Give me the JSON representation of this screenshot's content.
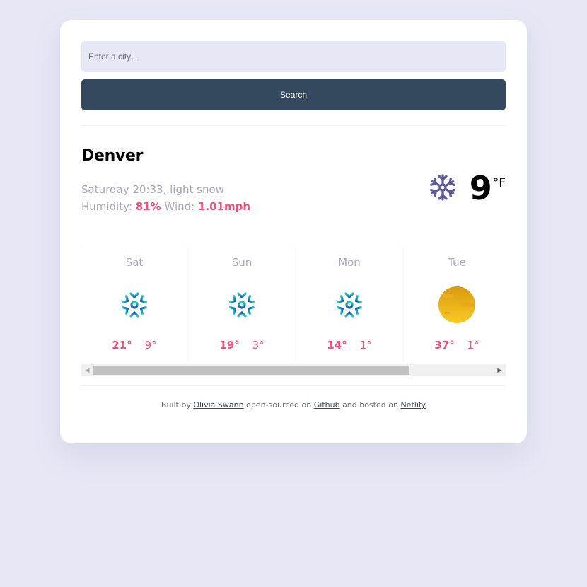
{
  "search": {
    "placeholder": "Enter a city...",
    "value": "",
    "button_label": "Search"
  },
  "current": {
    "city": "Denver",
    "day_time": "Saturday 20:33",
    "condition": "light snow",
    "humidity_label": "Humidity:",
    "humidity_value": "81%",
    "wind_label": "Wind:",
    "wind_value": "1.01mph",
    "icon": "snowflake-icon",
    "temperature": "9",
    "unit": "°F"
  },
  "forecast": [
    {
      "day": "Sat",
      "icon": "snowflake-icon",
      "high": "21°",
      "low": "9°"
    },
    {
      "day": "Sun",
      "icon": "snowflake-icon",
      "high": "19°",
      "low": "3°"
    },
    {
      "day": "Mon",
      "icon": "snowflake-icon",
      "high": "14°",
      "low": "1°"
    },
    {
      "day": "Tue",
      "icon": "sun-icon",
      "high": "37°",
      "low": "1°"
    }
  ],
  "scrollbar": {
    "position_fraction": 0.0,
    "visible_fraction": 0.79
  },
  "footer": {
    "prefix": "Built by",
    "author": "Olivia Swann",
    "middle": "open-sourced on",
    "repo": "Github",
    "middle2": "and hosted on",
    "host": "Netlify"
  },
  "colors": {
    "background": "#e6e8f5",
    "button": "#34495e",
    "accent": "#f0507a",
    "muted_text": "#a9a8bb"
  }
}
